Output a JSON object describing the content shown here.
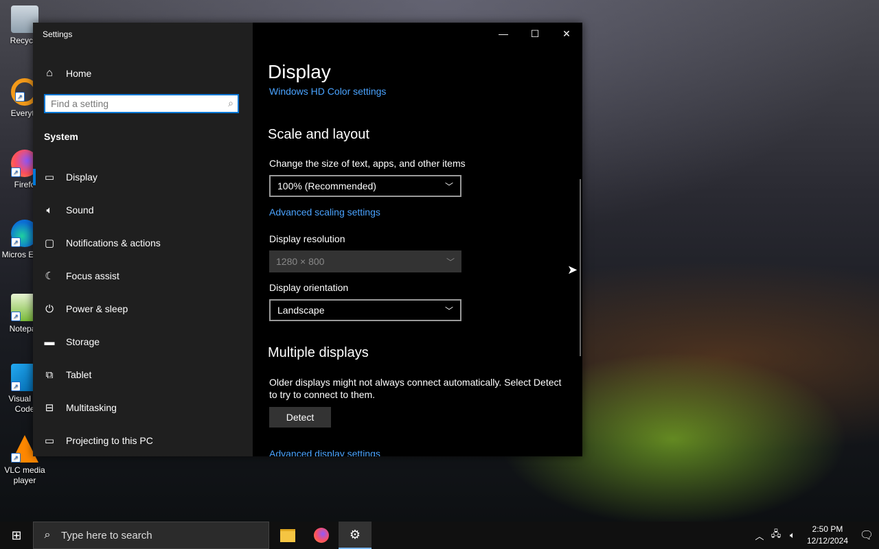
{
  "desktop": {
    "icons": [
      {
        "label": "Recycle",
        "icon": "recycle-bin-icon"
      },
      {
        "label": "Everyth",
        "icon": "everything-icon"
      },
      {
        "label": "Firefo",
        "icon": "firefox-icon"
      },
      {
        "label": "Micros Edge",
        "icon": "edge-icon"
      },
      {
        "label": "Notepac",
        "icon": "notepad-icon"
      },
      {
        "label": "Visual St Code",
        "icon": "vscode-icon"
      },
      {
        "label": "VLC media player",
        "icon": "vlc-icon"
      }
    ]
  },
  "window": {
    "title": "Settings",
    "controls": {
      "minimize": "—",
      "maximize": "☐",
      "close": "✕"
    }
  },
  "sidebar": {
    "home": {
      "label": "Home",
      "icon": "home-icon"
    },
    "search": {
      "placeholder": "Find a setting",
      "value": ""
    },
    "section": "System",
    "items": [
      {
        "label": "Display",
        "icon": "monitor-icon",
        "active": true
      },
      {
        "label": "Sound",
        "icon": "speaker-icon"
      },
      {
        "label": "Notifications & actions",
        "icon": "notification-icon"
      },
      {
        "label": "Focus assist",
        "icon": "moon-icon"
      },
      {
        "label": "Power & sleep",
        "icon": "power-icon"
      },
      {
        "label": "Storage",
        "icon": "storage-icon"
      },
      {
        "label": "Tablet",
        "icon": "tablet-icon"
      },
      {
        "label": "Multitasking",
        "icon": "multitasking-icon"
      },
      {
        "label": "Projecting to this PC",
        "icon": "projecting-icon"
      }
    ]
  },
  "main": {
    "title": "Display",
    "hd_color_link": "Windows HD Color settings",
    "scale_section": "Scale and layout",
    "scale_label": "Change the size of text, apps, and other items",
    "scale_value": "100% (Recommended)",
    "advanced_scaling_link": "Advanced scaling settings",
    "resolution_label": "Display resolution",
    "resolution_value": "1280 × 800",
    "orientation_label": "Display orientation",
    "orientation_value": "Landscape",
    "multiple_section": "Multiple displays",
    "multiple_desc": "Older displays might not always connect automatically. Select Detect to try to connect to them.",
    "detect_button": "Detect",
    "advanced_display_link": "Advanced display settings"
  },
  "taskbar": {
    "search_placeholder": "Type here to search",
    "apps": [
      {
        "name": "file-explorer",
        "icon": "folder-icon"
      },
      {
        "name": "firefox",
        "icon": "firefox-icon"
      },
      {
        "name": "settings",
        "icon": "gear-icon",
        "active": true
      }
    ],
    "time": "2:50 PM",
    "date": "12/12/2024"
  },
  "colors": {
    "accent": "#0078d7",
    "link": "#4aa3ff",
    "sidebar": "#1f1f1f"
  }
}
